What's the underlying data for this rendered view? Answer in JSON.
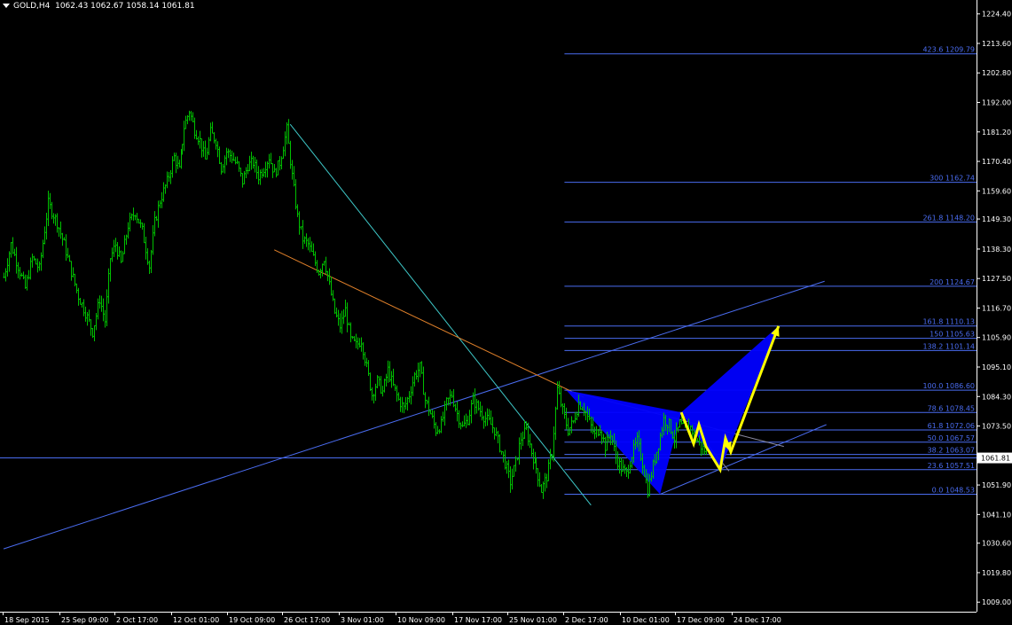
{
  "header": {
    "symbol": "GOLD,H4",
    "ohlc": "1062.43 1062.67 1058.14 1061.81"
  },
  "colors": {
    "background": "#000000",
    "candles": "#00c000",
    "axis": "#ffffff",
    "fib_lines": "#4a6cf0",
    "pattern_fill": "#0000ff",
    "projection": "#ffff00",
    "trend_cyan": "#3ec8c8",
    "trend_orange": "#e0802a",
    "current_price_bg": "#ffffff"
  },
  "chart_data": {
    "type": "candlestick",
    "title": "",
    "symbol": "GOLD",
    "timeframe": "H4",
    "last": {
      "open": 1062.43,
      "high": 1062.67,
      "low": 1058.14,
      "close": 1061.81
    },
    "current_price": "1061.81",
    "ylim": [
      1005.5,
      1229.5
    ],
    "y_ticks": [
      {
        "value": 1224.4,
        "label": "1224.40"
      },
      {
        "value": 1213.6,
        "label": "1213.60"
      },
      {
        "value": 1202.8,
        "label": "1202.80"
      },
      {
        "value": 1192.0,
        "label": "1192.00"
      },
      {
        "value": 1181.2,
        "label": "1181.20"
      },
      {
        "value": 1170.4,
        "label": "1170.40"
      },
      {
        "value": 1159.6,
        "label": "1159.60"
      },
      {
        "value": 1149.3,
        "label": "1149.30"
      },
      {
        "value": 1138.3,
        "label": "1138.30"
      },
      {
        "value": 1127.5,
        "label": "1127.50"
      },
      {
        "value": 1116.7,
        "label": "1116.70"
      },
      {
        "value": 1105.9,
        "label": "1105.90"
      },
      {
        "value": 1095.1,
        "label": "1095.10"
      },
      {
        "value": 1084.3,
        "label": "1084.30"
      },
      {
        "value": 1073.5,
        "label": "1073.50"
      },
      {
        "value": 1051.9,
        "label": "1051.90"
      },
      {
        "value": 1041.1,
        "label": "1041.10"
      },
      {
        "value": 1030.6,
        "label": "1030.60"
      },
      {
        "value": 1019.8,
        "label": "1019.80"
      },
      {
        "value": 1009.0,
        "label": "1009.00"
      }
    ],
    "x_ticks": [
      {
        "label": "18 Sep 2015",
        "index": 0
      },
      {
        "label": "25 Sep 09:00",
        "index": 32
      },
      {
        "label": "2 Oct 17:00",
        "index": 63
      },
      {
        "label": "12 Oct 01:00",
        "index": 95
      },
      {
        "label": "19 Oct 09:00",
        "index": 127
      },
      {
        "label": "26 Oct 17:00",
        "index": 158
      },
      {
        "label": "3 Nov 01:00",
        "index": 190
      },
      {
        "label": "10 Nov 09:00",
        "index": 222
      },
      {
        "label": "17 Nov 17:00",
        "index": 254
      },
      {
        "label": "25 Nov 01:00",
        "index": 285
      },
      {
        "label": "2 Dec 17:00",
        "index": 317
      },
      {
        "label": "10 Dec 01:00",
        "index": 349
      },
      {
        "label": "17 Dec 09:00",
        "index": 380
      },
      {
        "label": "24 Dec 17:00",
        "index": 412
      }
    ],
    "price_path": [
      [
        0,
        1128
      ],
      [
        4,
        1140
      ],
      [
        8,
        1132
      ],
      [
        12,
        1124
      ],
      [
        16,
        1135
      ],
      [
        20,
        1131
      ],
      [
        25,
        1155
      ],
      [
        30,
        1148
      ],
      [
        34,
        1140
      ],
      [
        38,
        1130
      ],
      [
        42,
        1121
      ],
      [
        46,
        1115
      ],
      [
        50,
        1108
      ],
      [
        54,
        1120
      ],
      [
        57,
        1112
      ],
      [
        60,
        1135
      ],
      [
        63,
        1140
      ],
      [
        66,
        1133
      ],
      [
        70,
        1147
      ],
      [
        74,
        1152
      ],
      [
        78,
        1145
      ],
      [
        82,
        1132
      ],
      [
        85,
        1148
      ],
      [
        88,
        1156
      ],
      [
        92,
        1163
      ],
      [
        96,
        1172
      ],
      [
        99,
        1167
      ],
      [
        102,
        1183
      ],
      [
        105,
        1189
      ],
      [
        108,
        1182
      ],
      [
        111,
        1178
      ],
      [
        114,
        1171
      ],
      [
        117,
        1181
      ],
      [
        120,
        1178
      ],
      [
        123,
        1168
      ],
      [
        126,
        1174
      ],
      [
        129,
        1172
      ],
      [
        132,
        1169
      ],
      [
        135,
        1163
      ],
      [
        138,
        1169
      ],
      [
        141,
        1170
      ],
      [
        144,
        1165
      ],
      [
        147,
        1168
      ],
      [
        150,
        1172
      ],
      [
        153,
        1166
      ],
      [
        156,
        1170
      ],
      [
        160,
        1182
      ],
      [
        163,
        1165
      ],
      [
        166,
        1150
      ],
      [
        169,
        1142
      ],
      [
        172,
        1140
      ],
      [
        175,
        1135
      ],
      [
        178,
        1130
      ],
      [
        181,
        1135
      ],
      [
        184,
        1125
      ],
      [
        187,
        1115
      ],
      [
        190,
        1110
      ],
      [
        193,
        1116
      ],
      [
        196,
        1105
      ],
      [
        199,
        1103
      ],
      [
        202,
        1105
      ],
      [
        205,
        1095
      ],
      [
        208,
        1085
      ],
      [
        211,
        1090
      ],
      [
        214,
        1086
      ],
      [
        217,
        1094
      ],
      [
        220,
        1088
      ],
      [
        223,
        1083
      ],
      [
        226,
        1080
      ],
      [
        229,
        1085
      ],
      [
        232,
        1092
      ],
      [
        235,
        1095
      ],
      [
        238,
        1083
      ],
      [
        241,
        1078
      ],
      [
        244,
        1072
      ],
      [
        247,
        1074
      ],
      [
        250,
        1082
      ],
      [
        253,
        1085
      ],
      [
        256,
        1078
      ],
      [
        259,
        1073
      ],
      [
        262,
        1076
      ],
      [
        265,
        1083
      ],
      [
        268,
        1080
      ],
      [
        271,
        1077
      ],
      [
        274,
        1075
      ],
      [
        277,
        1072
      ],
      [
        280,
        1066
      ],
      [
        283,
        1060
      ],
      [
        286,
        1053
      ],
      [
        289,
        1060
      ],
      [
        292,
        1069
      ],
      [
        295,
        1072
      ],
      [
        298,
        1064
      ],
      [
        301,
        1058
      ],
      [
        304,
        1050
      ],
      [
        307,
        1055
      ],
      [
        310,
        1064
      ],
      [
        313,
        1087
      ],
      [
        316,
        1079
      ],
      [
        319,
        1072
      ],
      [
        322,
        1075
      ],
      [
        325,
        1082
      ],
      [
        328,
        1080
      ],
      [
        331,
        1075
      ],
      [
        334,
        1070
      ],
      [
        337,
        1073
      ],
      [
        340,
        1066
      ],
      [
        343,
        1071
      ],
      [
        346,
        1062
      ],
      [
        349,
        1058
      ],
      [
        352,
        1056
      ],
      [
        355,
        1063
      ],
      [
        358,
        1068
      ],
      [
        361,
        1060
      ],
      [
        364,
        1050
      ],
      [
        367,
        1059
      ],
      [
        370,
        1067
      ],
      [
        373,
        1076
      ],
      [
        376,
        1074
      ],
      [
        379,
        1069
      ],
      [
        382,
        1074
      ],
      [
        385,
        1072
      ],
      [
        388,
        1073
      ],
      [
        391,
        1069
      ],
      [
        394,
        1066
      ],
      [
        397,
        1064
      ]
    ],
    "fibonacci_levels": [
      {
        "label": "423.6 1209.79",
        "price": 1209.79
      },
      {
        "label": "300 1162.74",
        "price": 1162.74
      },
      {
        "label": "261.8 1148.20",
        "price": 1148.2
      },
      {
        "label": "200 1124.67",
        "price": 1124.67
      },
      {
        "label": "161.8 1110.13",
        "price": 1110.13
      },
      {
        "label": "150 1105.63",
        "price": 1105.63
      },
      {
        "label": "138.2 1101.14",
        "price": 1101.14
      },
      {
        "label": "100.0 1086.60",
        "price": 1086.6
      },
      {
        "label": "78.6 1078.45",
        "price": 1078.45
      },
      {
        "label": "61.8 1072.06",
        "price": 1072.06
      },
      {
        "label": "50.0 1067.57",
        "price": 1067.57
      },
      {
        "label": "38.2 1063.07",
        "price": 1063.07
      },
      {
        "label": "23.6 1057.51",
        "price": 1057.51
      },
      {
        "label": "0.0 1048.53",
        "price": 1048.53
      }
    ],
    "fib_start_index": 317,
    "harmonic_pattern": {
      "X": [
        318,
        1086.6
      ],
      "A": [
        371,
        1048.5
      ],
      "B": [
        383,
        1078.5
      ],
      "C": [
        405,
        1057.5
      ],
      "D": [
        438,
        1110.1
      ]
    },
    "projection_path": [
      [
        383,
        1078.5
      ],
      [
        390,
        1067
      ],
      [
        393,
        1074
      ],
      [
        397,
        1066
      ],
      [
        405,
        1057.5
      ],
      [
        408,
        1069
      ],
      [
        411,
        1064
      ],
      [
        438,
        1110.1
      ]
    ],
    "trendlines": [
      {
        "name": "blue-rising",
        "color": "#4a6cf0",
        "from": [
          0,
          1028.5
        ],
        "to": [
          464,
          1126.5
        ]
      },
      {
        "name": "blue-channel-low",
        "color": "#4a6cf0",
        "from": [
          371,
          1048.5
        ],
        "to": [
          465,
          1074
        ]
      },
      {
        "name": "cyan-falling",
        "color": "#3ec8c8",
        "from": [
          162,
          1184
        ],
        "to": [
          332,
          1044.5
        ]
      },
      {
        "name": "orange-falling",
        "color": "#e0802a",
        "from": [
          153,
          1138
        ],
        "to": [
          328,
          1084
        ]
      },
      {
        "name": "grey-upper",
        "color": "#8a8aa0",
        "from": [
          318,
          1086.6
        ],
        "to": [
          441,
          1066
        ]
      },
      {
        "name": "grey-wedge",
        "color": "#8a8aa0",
        "from": [
          383,
          1078.5
        ],
        "to": [
          410,
          1057
        ]
      }
    ]
  }
}
